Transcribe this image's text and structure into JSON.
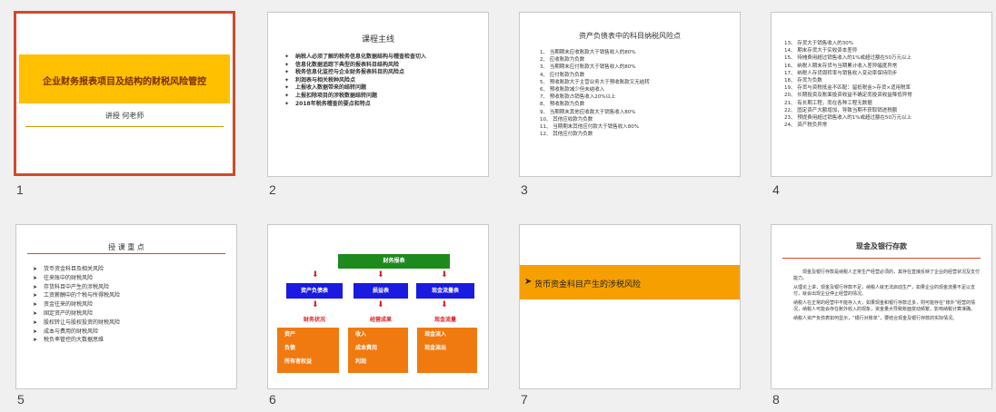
{
  "colors": {
    "selected_border": "#d04a2a",
    "yellow": "#ffc000",
    "orange_bar": "#f5a000",
    "green": "#1e8a1e",
    "blue": "#1a1ae0",
    "red": "#e02020",
    "orange_box": "#f07a10"
  },
  "slide1": {
    "num": "1",
    "title": "企业财务报表项目及结构的财税风险管控",
    "presenter": "讲授  何老师"
  },
  "slide2": {
    "num": "2",
    "title": "课程主线",
    "items": [
      "纳税人必须了解的税务信息化数据结构与稽查检查切入",
      "信息化数据追踪下典型的报表科目结构风险",
      "税务信息化监控与企业财务报表科目的风险点",
      "利润表与相关税种风险点",
      "上报收入数据带来的结转问题",
      "上报扣除项目的涉税数据结转问题",
      "2018年税务稽查的要点和特点"
    ]
  },
  "slide3": {
    "num": "3",
    "title": "资产负债表中的科目纳税风险点",
    "items": [
      "1、 当期期末应收账款大于销售收入的80%",
      "2、 应收账款为负数",
      "3、 当期期末应付账款大于销售收入的80%",
      "4、 应付账款为负数",
      "5、 预收账款大于主营业务大于预收账款又无结转",
      "6、 预收账款减少但未结收入",
      "7、 预收账款占销售收入20%以上",
      "8、 预收账款为负数",
      "9、 当期期末其他应收款大于销售收入80%",
      "10、 其他应收款为负数",
      "11、 当期期末其他应付款大于销售收入80%",
      "12、 其他应付款为负数"
    ]
  },
  "slide4": {
    "num": "4",
    "items": [
      "13、 存货大于销售收入的30%",
      "14、 期末存货大于实收资本差异",
      "15、 待摊费用超过销售收入的1%或超过额在50万元以上",
      "16、 纳税人期末存货与当期累计收入差异幅度异常",
      "17、 纳税人存货周转率与销售收入变动率保持同步",
      "18、 存货为负数",
      "19、 存货与资税抵金不匹配：留抵税金>存货×适用税率",
      "20、 长期投资及账面投资收益不确定而投资收益降低异常",
      "21、 有长期工程，而在各种工程无数据",
      "22、 固定资产大额增加，导致当期不获取销进税额",
      "23、 预提费用超过销售收入的1%或超过额在50万元以上",
      "24、 资产税负异常"
    ]
  },
  "slide5": {
    "num": "5",
    "title": "授 课 重 点",
    "items": [
      "货币资金科目及相关风险",
      "往来账中的财税风险",
      "存货科目中产生的涉税风险",
      "工资薪酬中的个税与所得税风险",
      "资金往来的财税风险",
      "固定资产的财税风险",
      "股权转让与股权投资的财税风险",
      "成本与费用的财税风险",
      "税负率管控的大数据思维"
    ]
  },
  "slide6": {
    "num": "6",
    "top": "财务报表",
    "mid": [
      "资产负债表",
      "损益表",
      "现金流量表"
    ],
    "labels": [
      "财务状况",
      "经营成果",
      "现金流量"
    ],
    "col1": [
      "资产",
      "负债",
      "所有者权益"
    ],
    "col2": [
      "收入",
      "成本费用",
      "利润"
    ],
    "col3": [
      "现金流入",
      "现金流出"
    ]
  },
  "slide7": {
    "num": "7",
    "title": "货币资金科目产生的涉税风险"
  },
  "slide8": {
    "num": "8",
    "title": "现金及银行存款",
    "paras": [
      "现金及银行存款是纳税人正常生产经营必须的，其存在直接反映了企业的经营状况及支付能力。",
      "从理论上讲，现金及银行存款不足，纳税人就无法启动生产，如果企业的现金流量不足以支付，就会出现企业停止经营的情况。",
      "纳税人在正常的经营中不能存入大，如果现金和银行存款过多，则可能存在“账外”经营的情况，纳税人可能会存在账外收入的现象，资金量大导致账面变动频繁，影响纳税计算准确。",
      "纳税人资产负债表如何显示，“银行对账单”，要结合现金及银行存款的实际情况。"
    ]
  }
}
